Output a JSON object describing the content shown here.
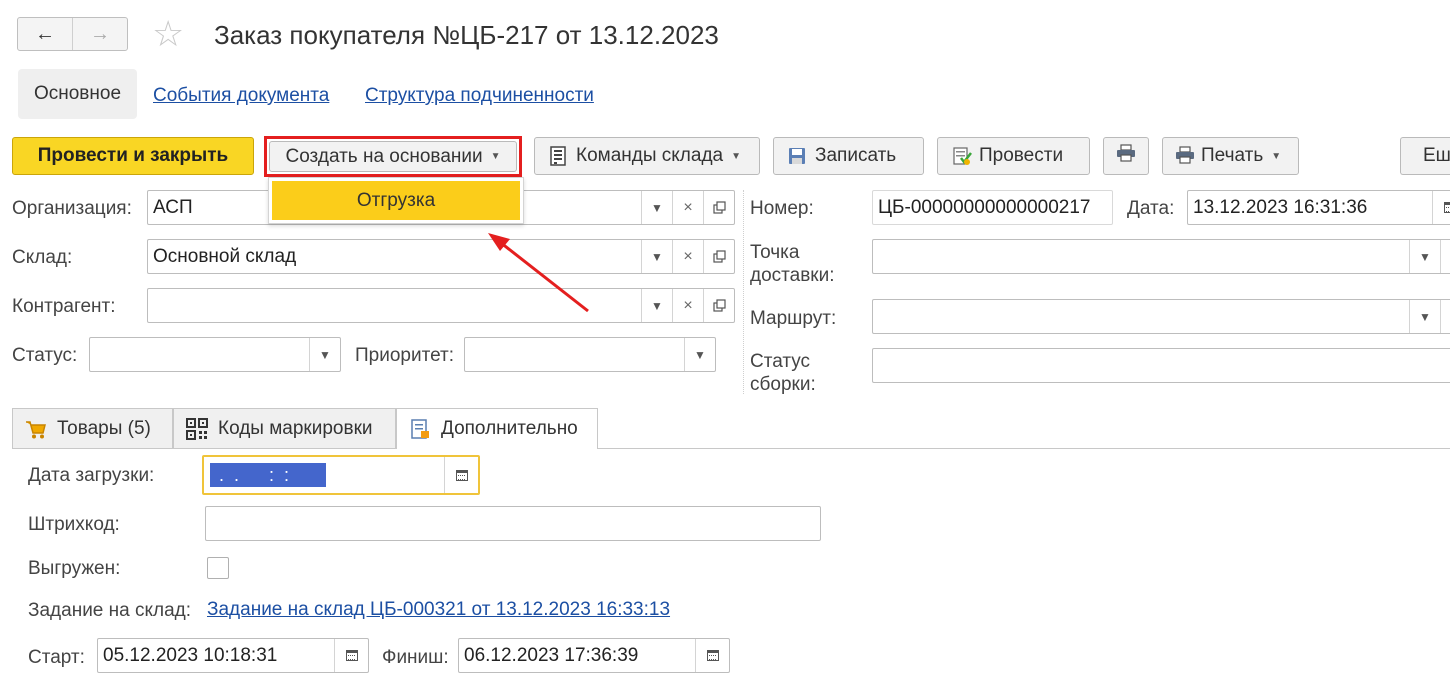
{
  "window": {
    "title": "Заказ покупателя №ЦБ-217 от 13.12.2023",
    "nav": {
      "back_icon": "←",
      "forward_icon": "→"
    },
    "favorite_icon": "☆"
  },
  "section_tabs": {
    "main": "Основное",
    "events": "События документа",
    "structure": "Структура подчиненности"
  },
  "toolbar": {
    "post_close": "Провести и закрыть",
    "create_based": "Создать на основании",
    "warehouse_cmds": "Команды склада",
    "save": "Записать",
    "post": "Провести",
    "print": "Печать",
    "more": "Еш"
  },
  "create_menu": {
    "items": [
      "Отгрузка"
    ]
  },
  "form": {
    "organization": {
      "label": "Организация:",
      "value": "АСП"
    },
    "warehouse": {
      "label": "Склад:",
      "value": "Основной склад"
    },
    "counterparty": {
      "label": "Контрагент:",
      "value": ""
    },
    "status": {
      "label": "Статус:",
      "value": ""
    },
    "priority": {
      "label": "Приоритет:",
      "value": ""
    },
    "number": {
      "label": "Номер:",
      "value": "ЦБ-00000000000000217"
    },
    "date": {
      "label": "Дата:",
      "value": "13.12.2023 16:31:36"
    },
    "delivery_point": {
      "label_line1": "Точка",
      "label_line2": "доставки:",
      "value": ""
    },
    "route": {
      "label": "Маршрут:",
      "value": ""
    },
    "assembly_status": {
      "label_line1": "Статус",
      "label_line2": "сборки:",
      "value": ""
    }
  },
  "tabs": [
    {
      "label": "Товары (5)",
      "icon": "cart-icon"
    },
    {
      "label": "Коды маркировки",
      "icon": "qr-icon"
    },
    {
      "label": "Дополнительно",
      "icon": "notepad-icon"
    }
  ],
  "additional": {
    "load_date": {
      "label": "Дата загрузки:",
      "value": " .  .      :  :  "
    },
    "barcode": {
      "label": "Штрихкод:",
      "value": ""
    },
    "unloaded": {
      "label": "Выгружен:",
      "checked": false
    },
    "warehouse_task": {
      "label": "Задание на склад:",
      "link": "Задание на склад ЦБ-000321 от 13.12.2023 16:33:13"
    },
    "start": {
      "label": "Старт:",
      "value": "05.12.2023 10:18:31"
    },
    "finish": {
      "label": "Финиш:",
      "value": "06.12.2023 17:36:39"
    }
  },
  "colors": {
    "accent": "#f9d624",
    "highlight": "#e41f1f",
    "link": "#1c4fa3",
    "selection": "#4466cc"
  }
}
